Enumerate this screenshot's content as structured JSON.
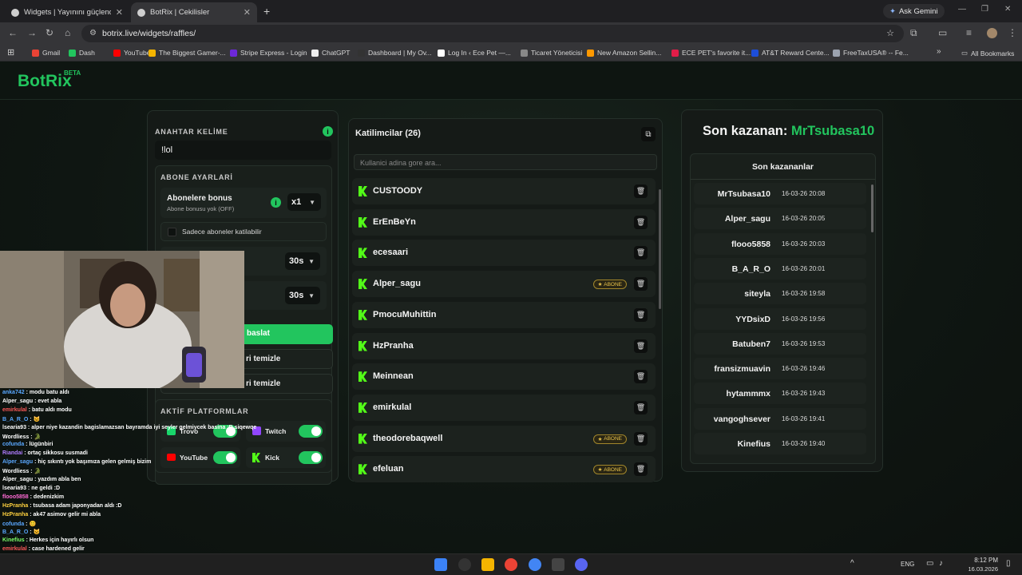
{
  "browser": {
    "tabs": [
      {
        "title": "Widgets | Yayınını güçlendirmek",
        "active": false
      },
      {
        "title": "BotRix | Cekilisler",
        "active": true
      }
    ],
    "ask_gemini": "Ask Gemini",
    "url": "botrix.live/widgets/raffles/",
    "bookmarks": [
      "Gmail",
      "Dash",
      "YouTube",
      "The Biggest Gamer-...",
      "Stripe Express - Login",
      "ChatGPT",
      "Dashboard | My Ov...",
      "Log In ‹ Ece Pet —...",
      "Ticaret Yöneticisi",
      "New Amazon Sellin...",
      "ECE PET's favorite it...",
      "AT&T Reward Cente...",
      "FreeTaxUSA® -- Fe..."
    ],
    "all_bookmarks": "All Bookmarks"
  },
  "site": {
    "logo": "BotRix",
    "logo_badge": "BETA"
  },
  "settings": {
    "keyword_label": "ANAHTAR KELİME",
    "keyword_value": "!lol",
    "sub_section": "ABONE AYARLARİ",
    "sub_bonus_title": "Abonelere bonus",
    "sub_bonus_sub": "Abone bonusu yok (OFF)",
    "sub_bonus_mult": "x1",
    "subs_only": "Sadece aboneler katilabilir",
    "timer1": "30s",
    "timer2": "30s",
    "start_btn": "baslat",
    "clear1": "ri temizle",
    "clear2": "ri temizle",
    "platforms_label": "AKTİF PLATFORMLAR",
    "platforms": [
      {
        "name": "Trovo",
        "on": true
      },
      {
        "name": "Twitch",
        "on": true
      },
      {
        "name": "YouTube",
        "on": true
      },
      {
        "name": "Kick",
        "on": true
      }
    ]
  },
  "participants": {
    "title": "Katilimcilar (26)",
    "search_placeholder": "Kullanici adina gore ara...",
    "badge_label": "ABONE",
    "list": [
      {
        "name": "CUSTOODY",
        "sub": false
      },
      {
        "name": "ErEnBeYn",
        "sub": false
      },
      {
        "name": "ecesaari",
        "sub": false
      },
      {
        "name": "Alper_sagu",
        "sub": true
      },
      {
        "name": "PmocuMuhittin",
        "sub": false
      },
      {
        "name": "HzPranha",
        "sub": false
      },
      {
        "name": "Meinnean",
        "sub": false
      },
      {
        "name": "emirkulal",
        "sub": false
      },
      {
        "name": "theodorebaqwell",
        "sub": true
      },
      {
        "name": "efeluan",
        "sub": true
      }
    ]
  },
  "winners": {
    "last_label": "Son kazanan: ",
    "last_name": "MrTsubasa10",
    "list_title": "Son kazananlar",
    "list": [
      {
        "name": "MrTsubasa10",
        "date": "16-03-26 20:08"
      },
      {
        "name": "Alper_sagu",
        "date": "16-03-26 20:05"
      },
      {
        "name": "flooo5858",
        "date": "16-03-26 20:03"
      },
      {
        "name": "B_A_R_O",
        "date": "16-03-26 20:01"
      },
      {
        "name": "siteyla",
        "date": "16-03-26 19:58"
      },
      {
        "name": "YYDsixD",
        "date": "16-03-26 19:56"
      },
      {
        "name": "Batuben7",
        "date": "16-03-26 19:53"
      },
      {
        "name": "fransizmuavin",
        "date": "16-03-26 19:46"
      },
      {
        "name": "hytammmx",
        "date": "16-03-26 19:43"
      },
      {
        "name": "vangoghsever",
        "date": "16-03-26 19:41"
      },
      {
        "name": "Kinefius",
        "date": "16-03-26 19:40"
      }
    ]
  },
  "chat": [
    {
      "user": "anka742",
      "msg": "modu batu aldı",
      "color": "#5aa8ff"
    },
    {
      "user": "Alper_sagu",
      "msg": "evet abla",
      "color": "#ffffff"
    },
    {
      "user": "emirkulal",
      "msg": "batu aldı modu",
      "color": "#ff5a5a"
    },
    {
      "user": "B_A_R_O",
      "msg": "😺",
      "color": "#5aa8ff"
    },
    {
      "user": "lsearia93",
      "msg": "alper niye kazandin bagislamazsan bayramda iyi seyler gelmiycek basina :D siqewqe",
      "color": "#ffffff"
    },
    {
      "user": "Wordliess",
      "msg": "🐊",
      "color": "#ffffff"
    },
    {
      "user": "cofunda",
      "msg": "lügünbiri",
      "color": "#5aa8ff"
    },
    {
      "user": "Riandai",
      "msg": "ortaç sikkosu susmadi",
      "color": "#b07cff"
    },
    {
      "user": "Alper_sagu",
      "msg": "hiç sıkıntı yok başımıza gelen gelmiş bizim",
      "color": "#5aa8ff"
    },
    {
      "user": "Wordliess",
      "msg": "🐊",
      "color": "#ffffff"
    },
    {
      "user": "Alper_sagu",
      "msg": "yazdım abla ben",
      "color": "#ffffff"
    },
    {
      "user": "lsearia93",
      "msg": "ne geldi :D",
      "color": "#ffffff"
    },
    {
      "user": "flooo5858",
      "msg": "dedenizkim",
      "color": "#ff6ad5"
    },
    {
      "user": "HzPranha",
      "msg": "tsubasa adam japonyadan aldı :D",
      "color": "#ffd23f"
    },
    {
      "user": "HzPranha",
      "msg": "ak47 asimov gelir mi abla",
      "color": "#ffd23f"
    },
    {
      "user": "cofunda",
      "msg": "😊",
      "color": "#5aa8ff"
    },
    {
      "user": "B_A_R_O",
      "msg": "😺",
      "color": "#5aa8ff"
    },
    {
      "user": "Kinefius",
      "msg": "Herkes için hayırlı olsun",
      "color": "#7cff6a"
    },
    {
      "user": "emirkulal",
      "msg": "case hardened gelir",
      "color": "#ff5a5a"
    }
  ],
  "taskbar": {
    "lang": "ENG",
    "time": "8:12 PM",
    "date": "16.03.2026"
  },
  "colors": {
    "accent": "#22c55e",
    "kick": "#53fc18"
  }
}
